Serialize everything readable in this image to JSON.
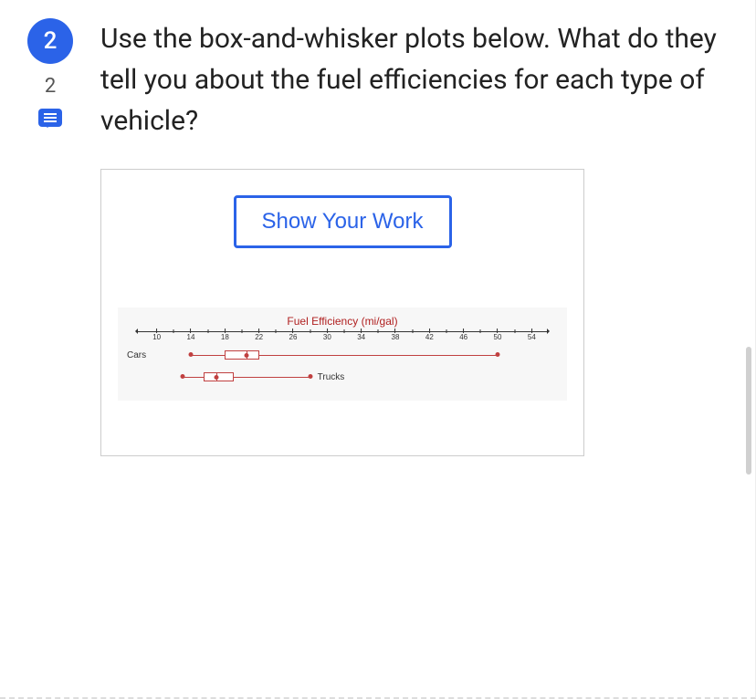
{
  "question": {
    "number": "2",
    "comment_count": "2",
    "text": "Use the box-and-whisker plots below. What do they tell you about the fuel efficiencies for each type of vehicle?"
  },
  "panel": {
    "show_work_label": "Show Your Work"
  },
  "chart_data": {
    "type": "boxplot",
    "title": "Fuel Efficiency (mi/gal)",
    "xlabel": "",
    "ylabel": "",
    "xlim": [
      8,
      56
    ],
    "ticks": [
      10,
      14,
      18,
      22,
      26,
      30,
      34,
      38,
      42,
      46,
      50,
      54
    ],
    "series": [
      {
        "name": "Cars",
        "min": 14,
        "q1": 18,
        "median": 20.5,
        "q3": 22,
        "max": 50
      },
      {
        "name": "Trucks",
        "min": 13,
        "q1": 15.5,
        "median": 17,
        "q3": 19,
        "max": 28
      }
    ]
  }
}
